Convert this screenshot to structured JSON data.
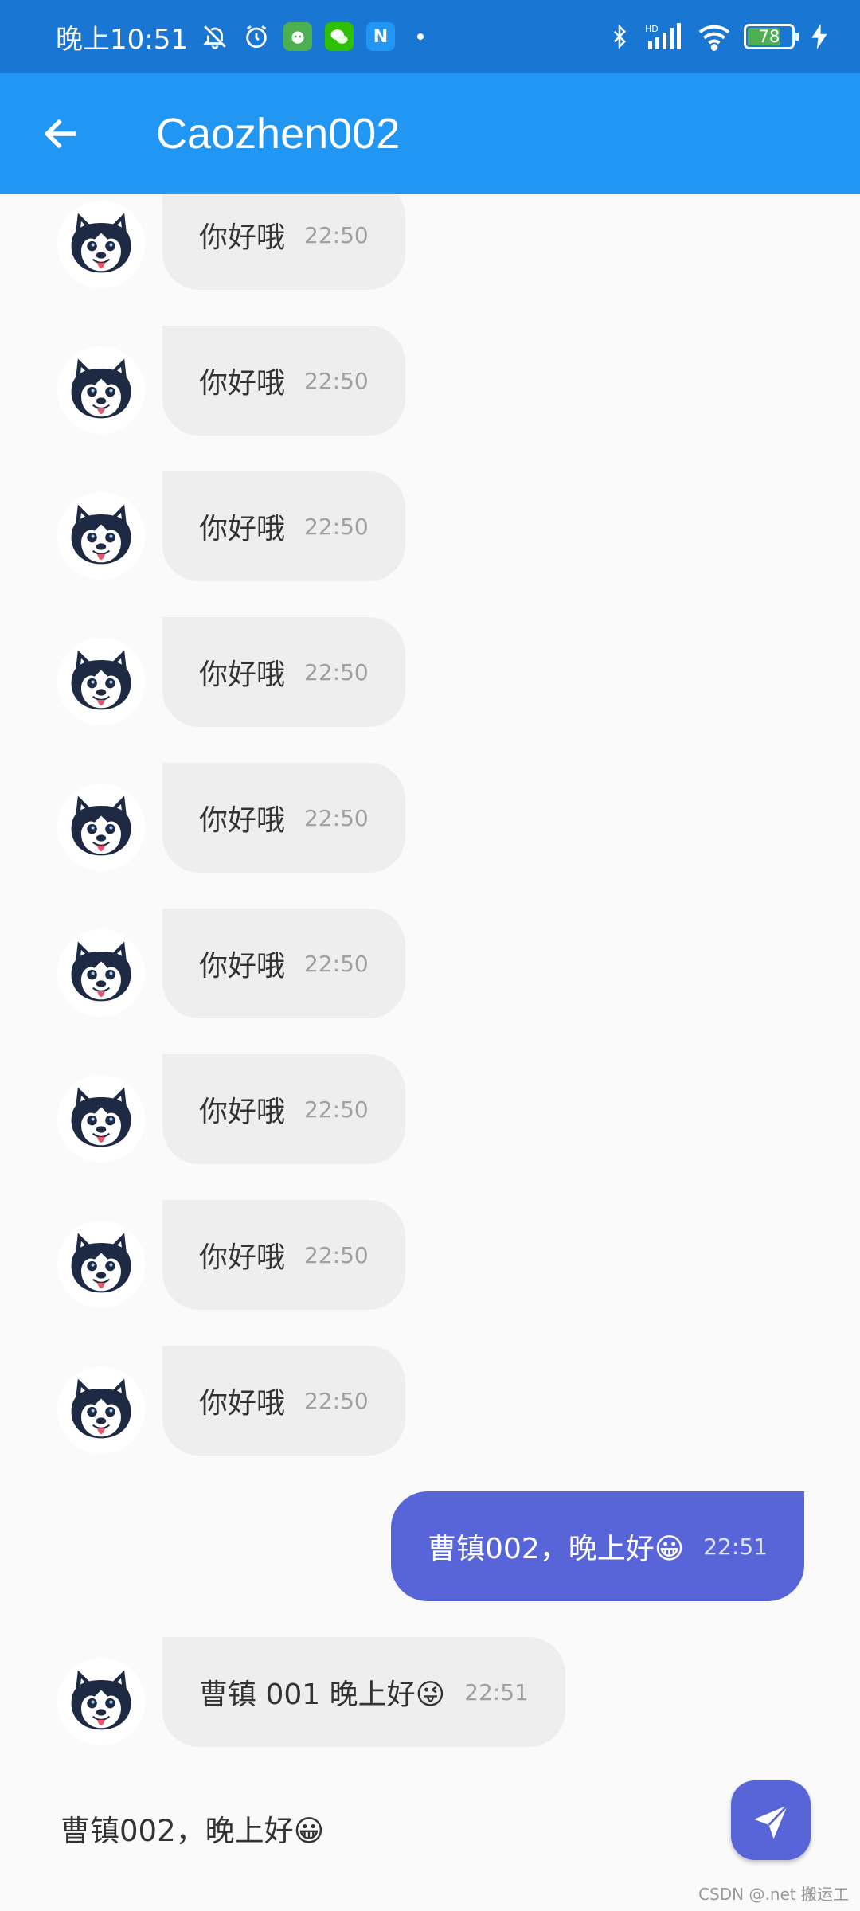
{
  "status_bar": {
    "time": "晚上10:51",
    "battery": "78",
    "network_label": "HD",
    "colors": {
      "background": "#1976d2",
      "battery_fill": "#4caf50"
    }
  },
  "app_bar": {
    "title": "Caozhen002",
    "back_icon": "arrow-left-icon",
    "color": "#2196f3"
  },
  "messages": [
    {
      "direction": "in",
      "text": "你好哦",
      "time": "22:50"
    },
    {
      "direction": "in",
      "text": "你好哦",
      "time": "22:50"
    },
    {
      "direction": "in",
      "text": "你好哦",
      "time": "22:50"
    },
    {
      "direction": "in",
      "text": "你好哦",
      "time": "22:50"
    },
    {
      "direction": "in",
      "text": "你好哦",
      "time": "22:50"
    },
    {
      "direction": "in",
      "text": "你好哦",
      "time": "22:50"
    },
    {
      "direction": "in",
      "text": "你好哦",
      "time": "22:50"
    },
    {
      "direction": "in",
      "text": "你好哦",
      "time": "22:50"
    },
    {
      "direction": "in",
      "text": "你好哦",
      "time": "22:50"
    },
    {
      "direction": "out",
      "text": "曹镇002，晚上好😀",
      "time": "22:51"
    },
    {
      "direction": "in",
      "text": "曹镇  001  晚上好😜",
      "time": "22:51"
    }
  ],
  "composer": {
    "input_value": "曹镇002，晚上好😀",
    "send_icon": "send-icon",
    "accent": "#5865d8"
  },
  "watermark": "CSDN @.net 搬运工"
}
